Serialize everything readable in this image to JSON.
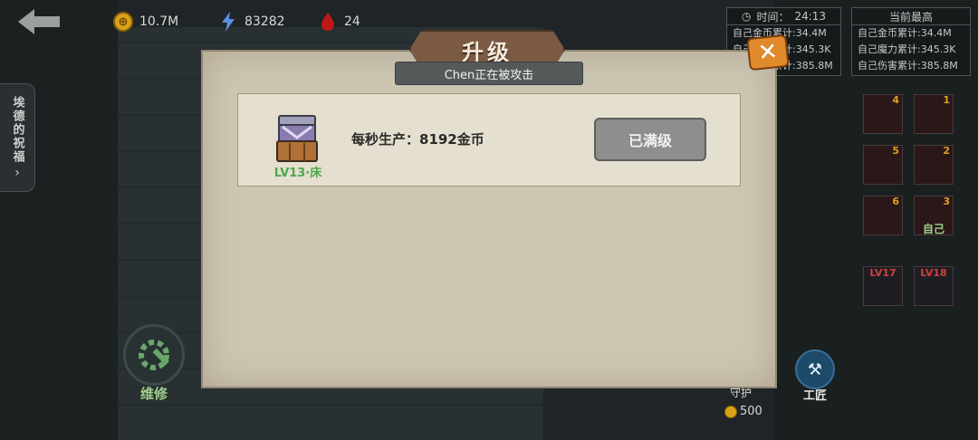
{
  "topbar": {
    "gold": "10.7M",
    "energy": "83282",
    "blood": "24"
  },
  "left": {
    "blessing_tab": "埃德的祝福",
    "repair_label": "维修"
  },
  "stats": {
    "time_label": "时间：",
    "time_value": "24:13",
    "self_lines": [
      "自己金币累计:34.4M",
      "自己魔力累计:345.3K",
      "自己伤害累计:385.8M"
    ],
    "record_title": "当前最高",
    "record_lines": [
      "自己金币累计:34.4M",
      "自己魔力累计:345.3K",
      "自己伤害累计:385.8M"
    ]
  },
  "players": [
    {
      "num": "4"
    },
    {
      "num": "1"
    },
    {
      "num": "5"
    },
    {
      "num": "2"
    },
    {
      "num": "6"
    },
    {
      "num": "3",
      "who": "自己"
    }
  ],
  "levels": [
    "LV17",
    "LV18"
  ],
  "bottom_right": {
    "guard_label": "守护",
    "craft_label": "工匠",
    "cost": "500"
  },
  "modal": {
    "title": "升级",
    "subtitle": "Chen正在被攻击",
    "close_icon": "close-x-icon",
    "item_level": "LV13·床",
    "production": "每秒生产：8192金币",
    "maxed_button": "已满级"
  },
  "colors": {
    "accent_orange": "#e08a2c",
    "banner_brown": "#7a5a44",
    "level_green": "#4ca84c",
    "gold": "#d9a21b"
  }
}
